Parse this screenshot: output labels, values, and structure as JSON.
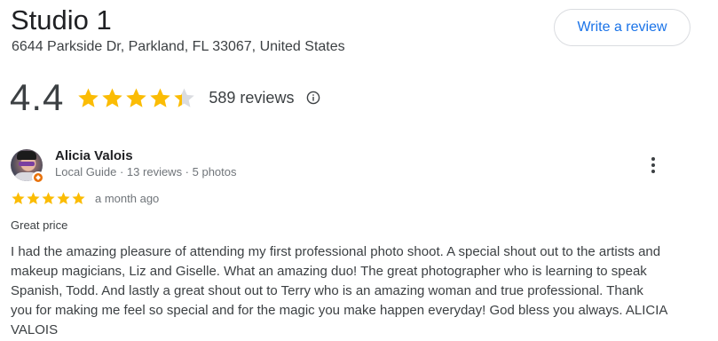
{
  "place": {
    "name": "Studio 1",
    "address": "6644 Parkside Dr, Parkland, FL 33067, United States",
    "write_review_label": "Write a review",
    "rating": "4.4",
    "rating_stars_value": 4.4,
    "review_count": "589 reviews"
  },
  "review": {
    "reviewer_name": "Alicia Valois",
    "reviewer_meta": "Local Guide · 13 reviews · 5 photos",
    "stars_value": 5,
    "time": "a month ago",
    "headline": "Great price",
    "text": "I had the amazing pleasure of attending my first professional photo shoot. A special shout out to the artists and makeup magicians, Liz and Giselle. What an amazing duo! The great photographer who is learning to speak Spanish, Todd. And lastly a great shout out to Terry who is an amazing woman and true professional. Thank you for making me feel so special and for the magic you make happen everyday! God bless you always. ALICIA VALOIS"
  },
  "colors": {
    "star": "#fbbc04",
    "star_empty": "#dadce0",
    "accent": "#1a73e8",
    "guide_badge": "#e8710a"
  },
  "icons": {
    "info": "info-icon",
    "more": "more-vert-icon",
    "star": "star-icon"
  }
}
